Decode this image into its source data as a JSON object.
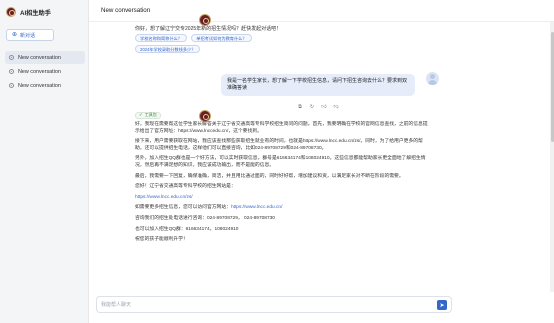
{
  "sidebar": {
    "app_title": "AI招生助手",
    "new_chat_label": "新对话",
    "conversations": [
      {
        "label": "New conversation"
      },
      {
        "label": "New conversation"
      },
      {
        "label": "New conversation"
      }
    ]
  },
  "header": {
    "title": "New conversation"
  },
  "welcome": {
    "text": "你好，想了解辽宁交专2025年新的招生情况吗？赶快发起对话吧！",
    "suggestions": [
      "学校名称和简称什么？",
      "单招考试如何为教育什么？",
      "2024年学校录取分数线多少？"
    ]
  },
  "user_message": {
    "text": "我是一名学生家长，想了解一下学校招生信息，请问下招生咨询去什么？要求到双准确答读"
  },
  "answer": {
    "tool_label": "工具包",
    "paragraphs": [
      "好，我现在需要帮这位学生家长解答关于辽宁省交通高等专科学校招生简问的问题。首先，我要明确在学校的官网信息查找，之前的信息提示给出了官方网址：https://www.lnccedu.cn/，这个要找到。",
      "接下来，用户需要获取在网站，我应该查找那些获取招生就业有的时间，也就是https://www.lncc.edu.cn/zs/。同时，为了给用户更多的帮助，还可以提供招生电话，这样他们可以直接咨询，比如024-89708729和024-89708730。",
      "另外，加入招生QQ群也是一个好方法，可以实时获取信息，群号是616634174和108024910。这些信息都能帮助家长更全面地了解招生情况，然后再不满足想的知识，我应该成功输出，而不是能的信息。",
      "最后，我需要一下回复，确保准确，简洁，并且用比通过面的，同时好好帮，增加建议和资，以满足家长对不断在阶段的需要。"
    ],
    "closing_intro": "您好！辽宁省交通高等专科学校的招生网站是：",
    "site_url": "https://www.lncc.edu.cn/zs/",
    "official_prefix": "如需要更多招生信息，您可以访问官方网站：",
    "official_url": "https://www.lncc.edu.cn/",
    "phone_line": "咨询我们的招生处电话进行咨询：024-89708729， 024-89708730",
    "qq_line": "也可以加入招生QQ群：616634174，108024910",
    "signoff": "祝您的孩子能顺利升学！"
  },
  "composer": {
    "placeholder": "我能帮人聊天"
  },
  "colors": {
    "accent": "#3567c9",
    "user_bubble": "#e6ecfa",
    "sidebar_bg": "#f4f5f7",
    "brand_logo": "#6a1f27"
  },
  "icons": {
    "logo": "school-emblem-icon",
    "new_chat": "plus-square-icon",
    "conversation": "chat-bubble-icon",
    "send": "send-icon",
    "copy": "copy-icon",
    "refresh": "refresh-icon",
    "like": "thumbs-up-icon",
    "dislike": "thumbs-down-icon"
  }
}
